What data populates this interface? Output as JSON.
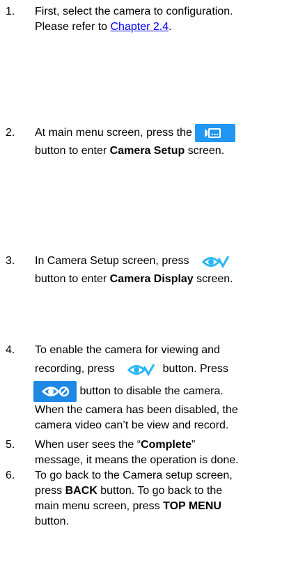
{
  "steps": [
    {
      "num": "1.",
      "line1": "First, select the camera to configuration.",
      "line2_pre": "Please refer to ",
      "line2_link": "Chapter 2.4",
      "line2_post": "."
    },
    {
      "num": "2.",
      "line1_pre": "At main menu screen, press the ",
      "line2_pre": "button to enter ",
      "line2_bold": "Camera Setup",
      "line2_post": " screen."
    },
    {
      "num": "3.",
      "line1_pre": "In Camera Setup screen, press ",
      "line2_pre": "button to enter ",
      "line2_bold": "Camera Display",
      "line2_post": " screen."
    },
    {
      "num": "4.",
      "line1": "To enable the camera for viewing and",
      "line2_pre": "recording, press ",
      "line2_post": " button. Press",
      "line3_post": " button to disable the camera.",
      "line4": "When the camera has been disabled, the",
      "line5": "camera video can’t be view and record."
    },
    {
      "num": "5.",
      "line1_pre": "When user sees the “",
      "line1_bold": "Complete",
      "line1_post": "”",
      "line2": "message, it means the operation is done."
    },
    {
      "num": "6.",
      "line1": "To go back to the Camera setup screen,",
      "line2_pre": "press ",
      "line2_bold": "BACK",
      "line2_post": " button. To go back to the",
      "line3_pre": "main menu screen, press ",
      "line3_bold": "TOP MENU",
      "line4": "button."
    }
  ],
  "icons": {
    "camera_setup": "camera-setup-icon",
    "camera_display": "camera-display-icon",
    "enable": "camera-enable-icon",
    "disable": "camera-disable-icon"
  }
}
